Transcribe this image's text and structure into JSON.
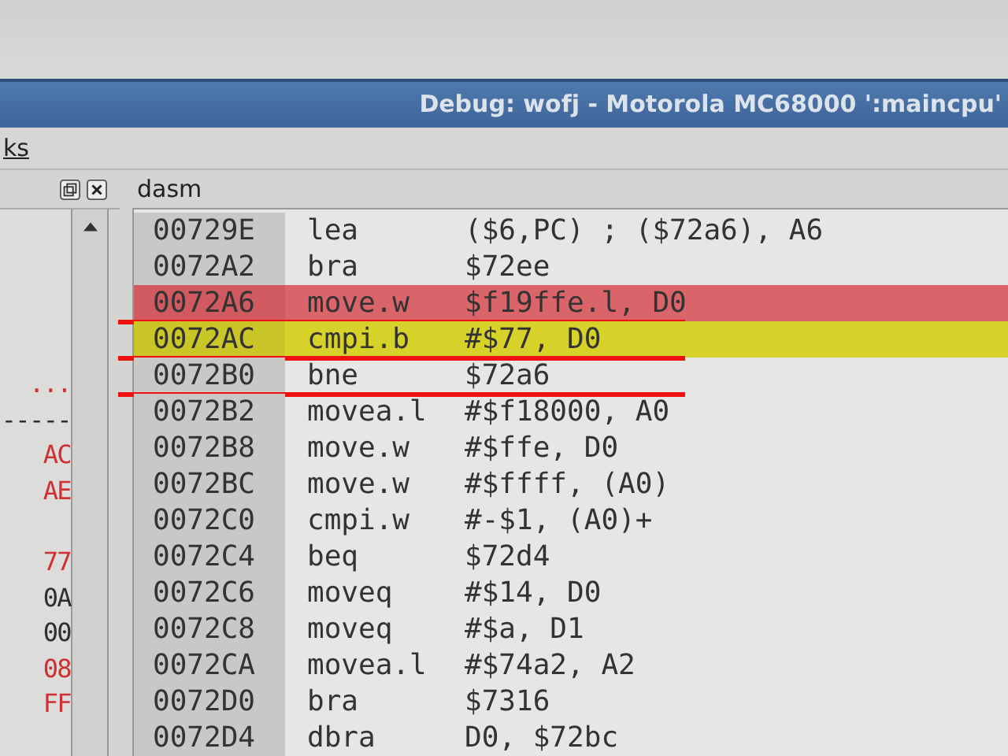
{
  "window": {
    "title": "Debug: wofj - Motorola MC68000 ':maincpu'"
  },
  "menu": [
    {
      "label": "ks",
      "mnemonic_underlined": true
    }
  ],
  "left_pane": {
    "blocks": [
      [
        {
          "text": "...",
          "color": "#d03030"
        },
        {
          "text": "-----",
          "color": "#303030"
        },
        {
          "text": "AC",
          "color": "#d03030"
        },
        {
          "text": "AE",
          "color": "#d03030"
        }
      ],
      [
        {
          "text": "77",
          "color": "#d03030"
        },
        {
          "text": "0A",
          "color": "#303030"
        },
        {
          "text": "00",
          "color": "#303030"
        },
        {
          "text": "08",
          "color": "#d03030"
        },
        {
          "text": "FF",
          "color": "#d03030"
        }
      ]
    ]
  },
  "dasm": {
    "title": "dasm",
    "rows": [
      {
        "address": "00729E",
        "mnemonic": "lea",
        "operands": "($6,PC) ; ($72a6), A6",
        "breakpoint": false,
        "current": false,
        "annotated": false
      },
      {
        "address": "0072A2",
        "mnemonic": "bra",
        "operands": "$72ee",
        "breakpoint": false,
        "current": false,
        "annotated": false
      },
      {
        "address": "0072A6",
        "mnemonic": "move.w",
        "operands": "$f19ffe.l, D0",
        "breakpoint": true,
        "current": false,
        "annotated": true
      },
      {
        "address": "0072AC",
        "mnemonic": "cmpi.b",
        "operands": "#$77, D0",
        "breakpoint": false,
        "current": true,
        "annotated": true
      },
      {
        "address": "0072B0",
        "mnemonic": "bne",
        "operands": "$72a6",
        "breakpoint": false,
        "current": false,
        "annotated": true
      },
      {
        "address": "0072B2",
        "mnemonic": "movea.l",
        "operands": "#$f18000, A0",
        "breakpoint": false,
        "current": false,
        "annotated": false
      },
      {
        "address": "0072B8",
        "mnemonic": "move.w",
        "operands": "#$ffe, D0",
        "breakpoint": false,
        "current": false,
        "annotated": false
      },
      {
        "address": "0072BC",
        "mnemonic": "move.w",
        "operands": "#$ffff, (A0)",
        "breakpoint": false,
        "current": false,
        "annotated": false
      },
      {
        "address": "0072C0",
        "mnemonic": "cmpi.w",
        "operands": "#-$1, (A0)+",
        "breakpoint": false,
        "current": false,
        "annotated": false
      },
      {
        "address": "0072C4",
        "mnemonic": "beq",
        "operands": "$72d4",
        "breakpoint": false,
        "current": false,
        "annotated": false
      },
      {
        "address": "0072C6",
        "mnemonic": "moveq",
        "operands": "#$14, D0",
        "breakpoint": false,
        "current": false,
        "annotated": false
      },
      {
        "address": "0072C8",
        "mnemonic": "moveq",
        "operands": "#$a, D1",
        "breakpoint": false,
        "current": false,
        "annotated": false
      },
      {
        "address": "0072CA",
        "mnemonic": "movea.l",
        "operands": "#$74a2, A2",
        "breakpoint": false,
        "current": false,
        "annotated": false
      },
      {
        "address": "0072D0",
        "mnemonic": "bra",
        "operands": "$7316",
        "breakpoint": false,
        "current": false,
        "annotated": false
      },
      {
        "address": "0072D4",
        "mnemonic": "dbra",
        "operands": "D0, $72bc",
        "breakpoint": false,
        "current": false,
        "annotated": false
      }
    ]
  }
}
